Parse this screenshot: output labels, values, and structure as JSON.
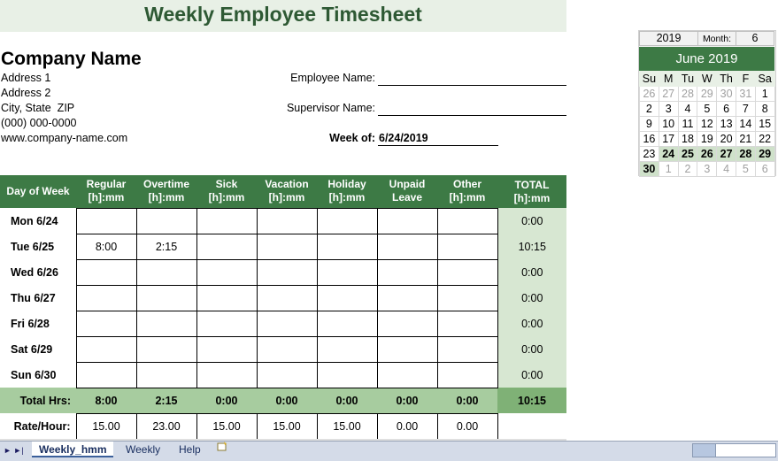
{
  "title": "Weekly Employee Timesheet",
  "company": {
    "name": "Company Name",
    "address1": "Address 1",
    "address2": "Address 2",
    "city": "City, State  ZIP",
    "phone": "(000) 000-0000",
    "web": "www.company-name.com"
  },
  "employee_label": "Employee Name:",
  "employee_value": "",
  "supervisor_label": "Supervisor Name:",
  "supervisor_value": "",
  "week_of_label": "Week of:",
  "week_of_value": "6/24/2019",
  "table": {
    "headers": [
      {
        "line1": "Day of Week",
        "line2": ""
      },
      {
        "line1": "Regular",
        "line2": "[h]:mm"
      },
      {
        "line1": "Overtime",
        "line2": "[h]:mm"
      },
      {
        "line1": "Sick",
        "line2": "[h]:mm"
      },
      {
        "line1": "Vacation",
        "line2": "[h]:mm"
      },
      {
        "line1": "Holiday",
        "line2": "[h]:mm"
      },
      {
        "line1": "Unpaid",
        "line2": "Leave"
      },
      {
        "line1": "Other",
        "line2": "[h]:mm"
      },
      {
        "line1": "TOTAL",
        "line2": "[h]:mm"
      }
    ],
    "rows": [
      {
        "day": "Mon 6/24",
        "cells": [
          "",
          "",
          "",
          "",
          "",
          "",
          ""
        ],
        "total": "0:00"
      },
      {
        "day": "Tue 6/25",
        "cells": [
          "8:00",
          "2:15",
          "",
          "",
          "",
          "",
          ""
        ],
        "total": "10:15"
      },
      {
        "day": "Wed 6/26",
        "cells": [
          "",
          "",
          "",
          "",
          "",
          "",
          ""
        ],
        "total": "0:00"
      },
      {
        "day": "Thu 6/27",
        "cells": [
          "",
          "",
          "",
          "",
          "",
          "",
          ""
        ],
        "total": "0:00"
      },
      {
        "day": "Fri 6/28",
        "cells": [
          "",
          "",
          "",
          "",
          "",
          "",
          ""
        ],
        "total": "0:00"
      },
      {
        "day": "Sat 6/29",
        "cells": [
          "",
          "",
          "",
          "",
          "",
          "",
          ""
        ],
        "total": "0:00"
      },
      {
        "day": "Sun 6/30",
        "cells": [
          "",
          "",
          "",
          "",
          "",
          "",
          ""
        ],
        "total": "0:00"
      }
    ],
    "totals_label": "Total Hrs:",
    "totals": [
      "8:00",
      "2:15",
      "0:00",
      "0:00",
      "0:00",
      "0:00",
      "0:00"
    ],
    "grand_total": "10:15",
    "rate_label": "Rate/Hour:",
    "rates": [
      "15.00",
      "23.00",
      "15.00",
      "15.00",
      "15.00",
      "0.00",
      "0.00"
    ]
  },
  "calendar": {
    "year": "2019",
    "month_label": "Month:",
    "month_num": "6",
    "header": "June 2019",
    "dow": [
      "Su",
      "M",
      "Tu",
      "W",
      "Th",
      "F",
      "Sa"
    ],
    "weeks": [
      [
        {
          "d": "26",
          "o": true
        },
        {
          "d": "27",
          "o": true
        },
        {
          "d": "28",
          "o": true
        },
        {
          "d": "29",
          "o": true
        },
        {
          "d": "30",
          "o": true
        },
        {
          "d": "31",
          "o": true
        },
        {
          "d": "1"
        }
      ],
      [
        {
          "d": "2"
        },
        {
          "d": "3"
        },
        {
          "d": "4"
        },
        {
          "d": "5"
        },
        {
          "d": "6"
        },
        {
          "d": "7"
        },
        {
          "d": "8"
        }
      ],
      [
        {
          "d": "9"
        },
        {
          "d": "10"
        },
        {
          "d": "11"
        },
        {
          "d": "12"
        },
        {
          "d": "13"
        },
        {
          "d": "14"
        },
        {
          "d": "15"
        }
      ],
      [
        {
          "d": "16"
        },
        {
          "d": "17"
        },
        {
          "d": "18"
        },
        {
          "d": "19"
        },
        {
          "d": "20"
        },
        {
          "d": "21"
        },
        {
          "d": "22"
        }
      ],
      [
        {
          "d": "23"
        },
        {
          "d": "24",
          "w": true
        },
        {
          "d": "25",
          "w": true
        },
        {
          "d": "26",
          "w": true
        },
        {
          "d": "27",
          "w": true
        },
        {
          "d": "28",
          "w": true
        },
        {
          "d": "29",
          "w": true
        }
      ],
      [
        {
          "d": "30",
          "w": true
        },
        {
          "d": "1",
          "o": true
        },
        {
          "d": "2",
          "o": true
        },
        {
          "d": "3",
          "o": true
        },
        {
          "d": "4",
          "o": true
        },
        {
          "d": "5",
          "o": true
        },
        {
          "d": "6",
          "o": true
        }
      ]
    ]
  },
  "tabs": {
    "nav": "► ►|",
    "active": "Weekly_hmm",
    "second": "Weekly",
    "third": "Help",
    "add_icon": "new-sheet-icon"
  },
  "colors": {
    "header_green": "#3d7a45",
    "title_green": "#2e5934",
    "total_col": "#d7e7d2",
    "totals_row": "#a7cc9f"
  }
}
